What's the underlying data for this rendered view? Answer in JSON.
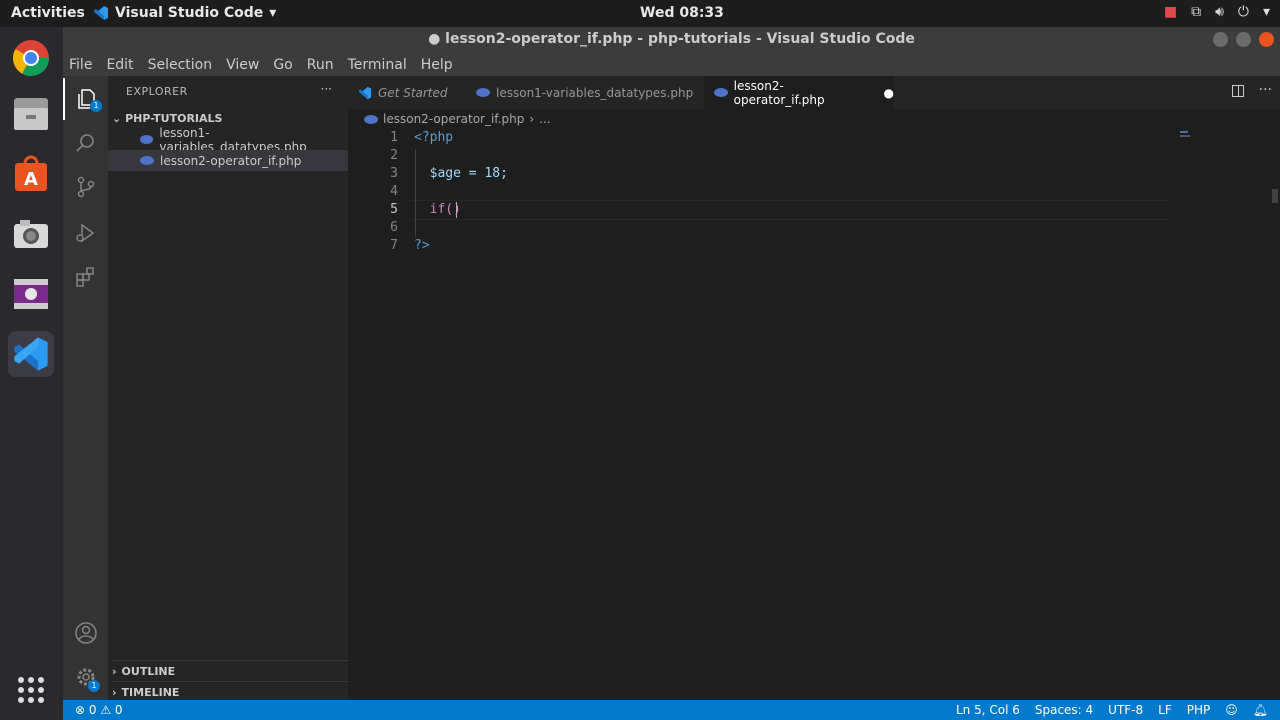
{
  "topbar": {
    "activities": "Activities",
    "app_name": "Visual Studio Code",
    "clock": "Wed 08:33"
  },
  "window": {
    "title": "● lesson2-operator_if.php - php-tutorials - Visual Studio Code"
  },
  "menu": [
    "File",
    "Edit",
    "Selection",
    "View",
    "Go",
    "Run",
    "Terminal",
    "Help"
  ],
  "sidebar": {
    "header": "EXPLORER",
    "more": "···",
    "folder": "PHP-TUTORIALS",
    "files": [
      "lesson1-variables_datatypes.php",
      "lesson2-operator_if.php"
    ],
    "outline": "OUTLINE",
    "timeline": "TIMELINE",
    "explorer_badge": "1",
    "settings_badge": "1"
  },
  "tabs": [
    {
      "label": "Get Started"
    },
    {
      "label": "lesson1-variables_datatypes.php"
    },
    {
      "label": "lesson2-operator_if.php"
    }
  ],
  "editor": {
    "breadcrumb_file": "lesson2-operator_if.php",
    "breadcrumb_more": "...",
    "line_numbers": [
      "1",
      "2",
      "3",
      "4",
      "5",
      "6",
      "7"
    ],
    "lines": [
      "<?php",
      "",
      "  $age = 18;",
      "",
      "  if()",
      "",
      "?>"
    ]
  },
  "status": {
    "problems": "⊗ 0 ⚠ 0",
    "position": "Ln 5, Col 6",
    "spaces": "Spaces: 4",
    "encoding": "UTF-8",
    "eol": "LF",
    "language": "PHP"
  },
  "colors": {
    "accent": "#007acc",
    "php_tag": "#569cd6",
    "variable": "#9cdcfe",
    "number": "#b5cea8",
    "keyword": "#c586c0"
  }
}
